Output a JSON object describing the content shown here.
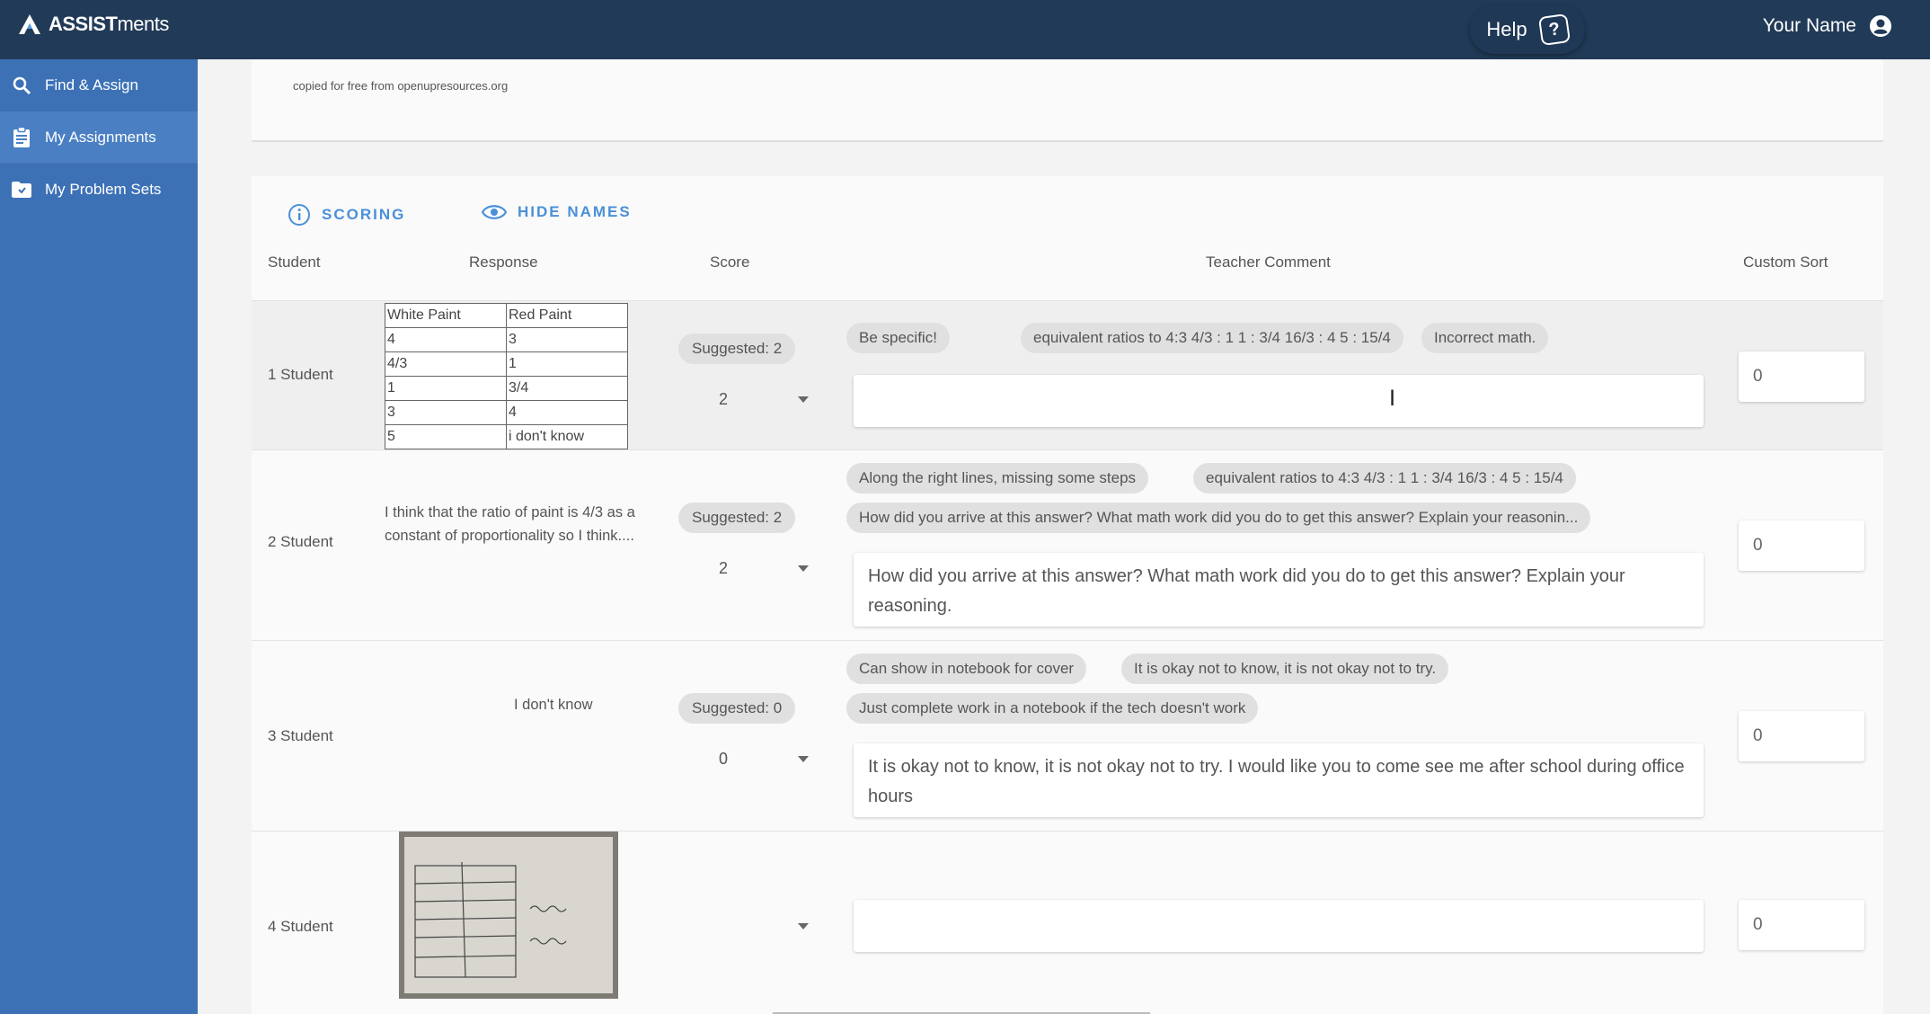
{
  "app": {
    "logo_bold": "ASSIST",
    "logo_light": "ments",
    "help_label": "Help",
    "help_icon": "help-question-icon",
    "user_name": "Your Name",
    "user_icon": "account-circle-icon"
  },
  "sidebar": {
    "items": [
      {
        "label": "Find & Assign",
        "icon": "search-icon",
        "active": false
      },
      {
        "label": "My Assignments",
        "icon": "clipboard-icon",
        "active": true
      },
      {
        "label": "My Problem Sets",
        "icon": "folder-icon",
        "active": false
      }
    ]
  },
  "problem": {
    "attribution": "copied for free from openupresources.org"
  },
  "toolbar": {
    "scoring_label": "SCORING",
    "hide_names_label": "HIDE NAMES"
  },
  "columns": {
    "student": "Student",
    "response": "Response",
    "score": "Score",
    "teacher_comment": "Teacher Comment",
    "custom_sort": "Custom Sort"
  },
  "rows": [
    {
      "student": "1 Student",
      "response_table": [
        [
          "White Paint",
          "Red Paint"
        ],
        [
          "4",
          "3"
        ],
        [
          "4/3",
          "1"
        ],
        [
          "1",
          "3/4"
        ],
        [
          "3",
          "4"
        ],
        [
          "5",
          "i don't know"
        ]
      ],
      "suggested": "Suggested: 2",
      "score": "2",
      "chips": [
        "Be specific!",
        "equivalent ratios to 4:3 4/3 : 1 1 : 3/4 16/3 : 4 5 : 15/4",
        "Incorrect math."
      ],
      "comment": "",
      "sort": "0"
    },
    {
      "student": "2 Student",
      "response_text": "I think that the ratio of paint is 4/3 as a constant of proportionality so I think....",
      "suggested": "Suggested: 2",
      "score": "2",
      "chips": [
        "Along the right lines, missing some steps",
        "equivalent ratios to 4:3 4/3 : 1 1 : 3/4 16/3 : 4 5 : 15/4",
        "How did you arrive at this answer? What math work did you do to get this answer? Explain your reasonin..."
      ],
      "comment": "How did you arrive at this answer? What math work did you do to get this answer? Explain your reasoning.",
      "sort": "0"
    },
    {
      "student": "3 Student",
      "response_text": "I don't know",
      "suggested": "Suggested: 0",
      "score": "0",
      "chips": [
        "Can show in notebook for cover",
        "It is okay not to know, it is not okay not to try.",
        "Just complete work in a notebook if the tech doesn't work"
      ],
      "comment": "It is okay not to know, it is not okay not to try. I would like you to come see me after school during office hours",
      "sort": "0"
    },
    {
      "student": "4 Student",
      "response_image": "handwritten-table-photo",
      "score": "",
      "comment": "",
      "sort": "0"
    }
  ],
  "colors": {
    "topbar": "#213a57",
    "sidebar": "#3d71b6",
    "accent": "#4a90d9"
  }
}
